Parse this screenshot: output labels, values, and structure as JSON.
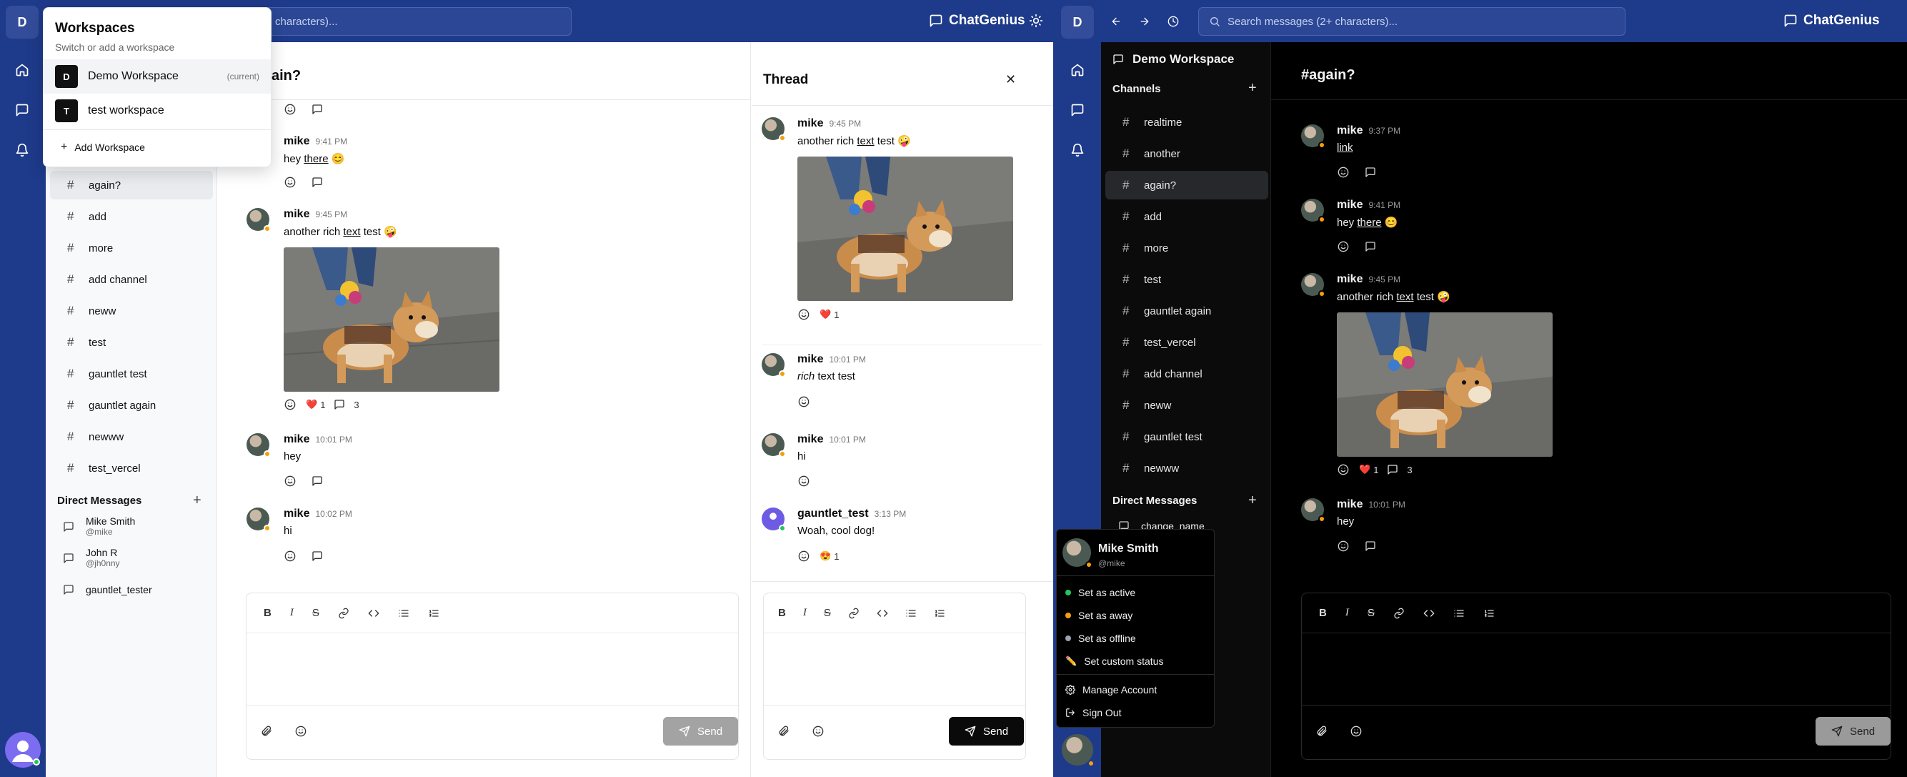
{
  "colors": {
    "brand_bar": "#1e3a8a",
    "accent_online": "#22c55e",
    "accent_away": "#f59e0b",
    "heart": "#e11d48"
  },
  "app": {
    "brand": "ChatGenius",
    "workspace_initial": "D"
  },
  "search": {
    "placeholder_left": "characters)...",
    "placeholder_right": "Search messages (2+ characters)..."
  },
  "workspace_popover": {
    "title": "Workspaces",
    "subtitle": "Switch or add a workspace",
    "items": [
      {
        "initial": "D",
        "name": "Demo Workspace",
        "tag": "(current)"
      },
      {
        "initial": "T",
        "name": "test workspace",
        "tag": ""
      }
    ],
    "add_label": "Add Workspace"
  },
  "left": {
    "channel_title": "ain?",
    "channels": [
      "again?",
      "add",
      "more",
      "add channel",
      "neww",
      "test",
      "gauntlet test",
      "gauntlet again",
      "newww",
      "test_vercel"
    ],
    "dm_title": "Direct Messages",
    "dms": [
      {
        "name": "Mike Smith",
        "handle": "@mike"
      },
      {
        "name": "John R",
        "handle": "@jh0nny"
      },
      {
        "name": "gauntlet_tester",
        "handle": ""
      }
    ],
    "messages": [
      {
        "user": "mike",
        "time": "9:41 PM",
        "pre": "hey ",
        "link": "there",
        "post": " 😊"
      },
      {
        "user": "mike",
        "time": "9:45 PM",
        "pre": "another rich ",
        "link": "text",
        "post": " test 🤪",
        "heart_count": "1",
        "reply_count": "3"
      },
      {
        "user": "mike",
        "time": "10:01 PM",
        "text": "hey"
      },
      {
        "user": "mike",
        "time": "10:02 PM",
        "text": "hi"
      }
    ],
    "send_label": "Send",
    "thread": {
      "title": "Thread",
      "messages": [
        {
          "user": "mike",
          "time": "9:45 PM",
          "pre": "another rich ",
          "link": "text",
          "post": " test 🤪",
          "heart_count": "1"
        },
        {
          "user": "mike",
          "time": "10:01 PM",
          "italic": "rich",
          "post": " text test"
        },
        {
          "user": "mike",
          "time": "10:01 PM",
          "text": "hi"
        },
        {
          "user": "gauntlet_test",
          "time": "3:13 PM",
          "text": "Woah, cool dog!",
          "react_count": "1"
        }
      ],
      "send_label": "Send"
    }
  },
  "right": {
    "workspace_name": "Demo Workspace",
    "channels_title": "Channels",
    "channel_title": "#again?",
    "channels": [
      "realtime",
      "another",
      "again?",
      "add",
      "more",
      "test",
      "gauntlet again",
      "test_vercel",
      "add channel",
      "neww",
      "gauntlet test",
      "newww"
    ],
    "dm_title": "Direct Messages",
    "dm_partial": "change_name",
    "messages": [
      {
        "user": "mike",
        "time": "9:37 PM",
        "link": "link"
      },
      {
        "user": "mike",
        "time": "9:41 PM",
        "pre": "hey ",
        "link": "there",
        "post": " 😊"
      },
      {
        "user": "mike",
        "time": "9:45 PM",
        "pre": "another rich ",
        "link": "text",
        "post": " test 🤪",
        "heart_count": "1",
        "reply_count": "3"
      },
      {
        "user": "mike",
        "time": "10:01 PM",
        "text": "hey"
      }
    ],
    "send_label": "Send",
    "user_menu": {
      "name": "Mike Smith",
      "handle": "@mike",
      "statuses": [
        {
          "label": "Set as active",
          "color": "#22c55e"
        },
        {
          "label": "Set as away",
          "color": "#f59e0b"
        },
        {
          "label": "Set as offline",
          "color": "#9ca3af"
        }
      ],
      "custom_status": "Set custom status",
      "manage": "Manage Account",
      "signout": "Sign Out"
    }
  }
}
